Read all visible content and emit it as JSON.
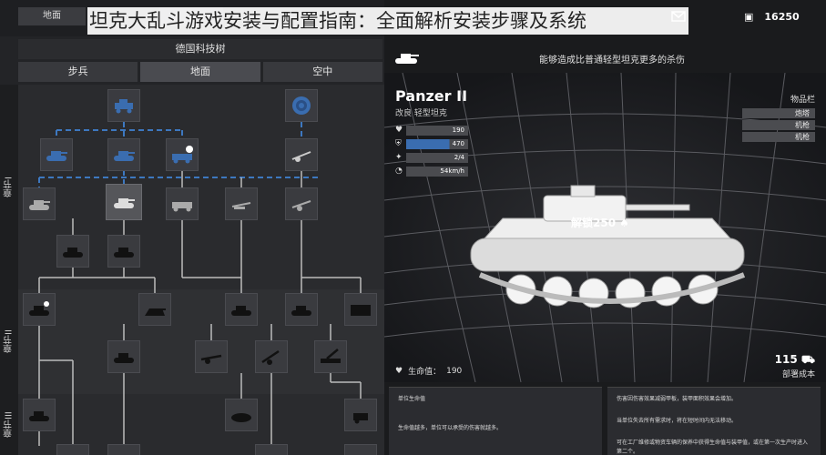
{
  "topbar": {
    "map_label": "地面",
    "money_value": "16250",
    "overlay_title": "坦克大乱斗游戏安装与配置指南：全面解析安装步骤及系统"
  },
  "tech_tree": {
    "title": "德国科技树",
    "tabs": [
      {
        "label": "步兵",
        "active": false
      },
      {
        "label": "地面",
        "active": true
      },
      {
        "label": "空中",
        "active": false
      }
    ],
    "chapters": [
      "章节I",
      "章节II",
      "章节III"
    ]
  },
  "detail": {
    "caption": "能够造成比普通轻型坦克更多的杀伤",
    "tank_name": "Panzer II",
    "tank_sub": "改良 轻型坦克",
    "stats": [
      {
        "icon": "♥",
        "value": "190"
      },
      {
        "icon": "⛨",
        "value": "470"
      },
      {
        "icon": "✦",
        "value": "2/4"
      },
      {
        "icon": "◔",
        "value": "54km/h"
      }
    ],
    "items_header": "物品栏",
    "items": [
      "炮塔",
      "机枪",
      "机枪"
    ],
    "unlock_label": "解锁250",
    "hp_label": "生命值：",
    "hp_value": "190",
    "deploy_value": "115",
    "deploy_label": "部署成本",
    "info_left_title": "单位生命值",
    "info_left_text": "生命值越多，单位可以承受的伤害就越多。",
    "info_right_lines": [
      "伤害因伤害效果减弱甲板，装甲面积效果会增加。",
      "当单位失去所有需求时，将在短时间内无法移动。",
      "可在工厂维修或物资车辆的保养中获得生命值与装甲值，或在第一次生产时进入第二个。"
    ]
  },
  "colors": {
    "accent_blue": "#3a6db0",
    "panel_dark": "#232427",
    "line_blue": "#3d78c0"
  }
}
